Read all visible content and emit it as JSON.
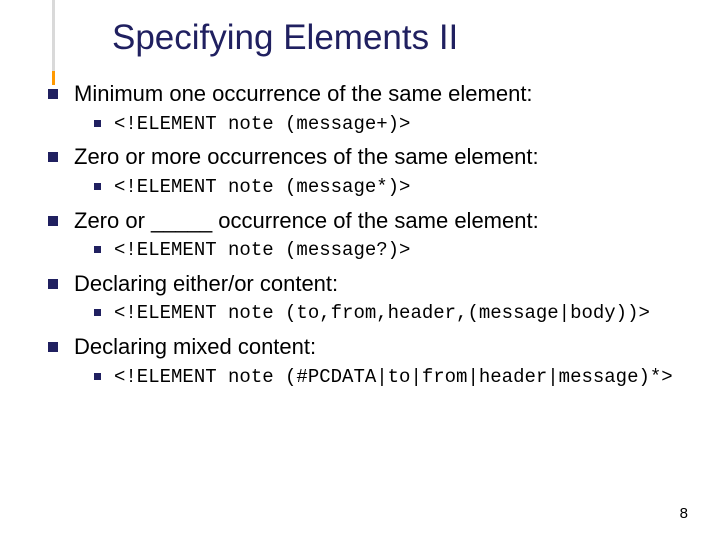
{
  "slide": {
    "title": "Specifying Elements II",
    "bullets": [
      {
        "text": "Minimum one occurrence of the same element:",
        "code": "<!ELEMENT note (message+)>"
      },
      {
        "text": "Zero or more occurrences of the same element:",
        "code": "<!ELEMENT note (message*)>"
      },
      {
        "text": "Zero or _____ occurrence of the same element:",
        "code": "<!ELEMENT note (message?)>"
      },
      {
        "text": "Declaring either/or content:",
        "code": "<!ELEMENT note (to,from,header,(message|body))>"
      },
      {
        "text": "Declaring mixed content:",
        "code": "<!ELEMENT note (#PCDATA|to|from|header|message)*>"
      }
    ],
    "page_number": "8"
  }
}
